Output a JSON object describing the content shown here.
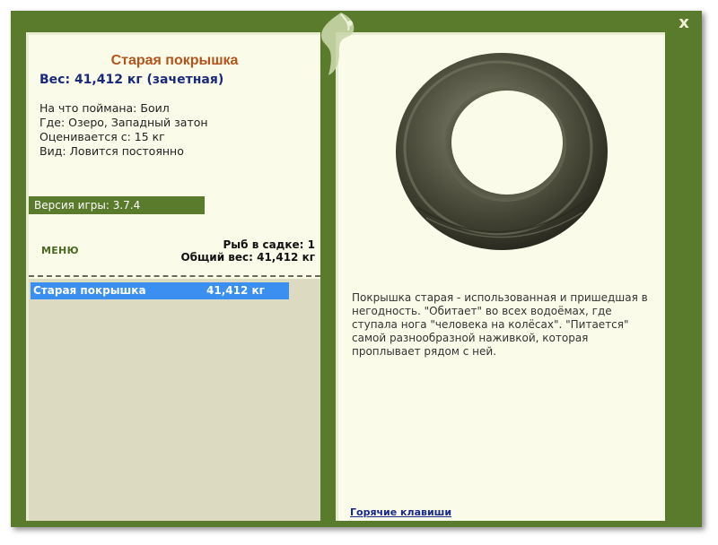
{
  "window": {
    "close_label": "x"
  },
  "fish": {
    "title": "Старая покрышка",
    "weight_line": "Вес: 41,412 кг (зачетная)",
    "caught_on": "На что поймана: Боил",
    "location": "Где: Озеро, Западный затон",
    "valued_from": "Оценивается с: 15 кг",
    "kind": "Вид: Ловится постоянно",
    "description": "Покрышка старая - использованная и пришедшая в негодность. \"Обитает\" во всех водоёмах, где ступала нога \"человека на колёсах\". \"Питается\" самой разнообразной наживкой, которая проплывает рядом с ней."
  },
  "sidebar": {
    "version": "Версия игры: 3.7.4",
    "menu_label": "МЕНЮ",
    "catch_count": "Рыб в садке: 1",
    "catch_total": "Общий вес: 41,412 кг"
  },
  "catch_list": {
    "items": [
      {
        "name": "Старая покрышка",
        "weight": "41,412 кг"
      }
    ]
  },
  "footer": {
    "hotkeys_label": "Горячие клавиши"
  },
  "colors": {
    "frame_green": "#5a7a2c",
    "panel_bg": "#fbfbea",
    "title_orange": "#b4541a",
    "weight_blue": "#1a2a7a",
    "selection_blue": "#3a8ff0",
    "list_bg": "#dcdac0"
  },
  "icons": {
    "close": "close-icon",
    "emblem": "leaf-emblem-icon"
  }
}
